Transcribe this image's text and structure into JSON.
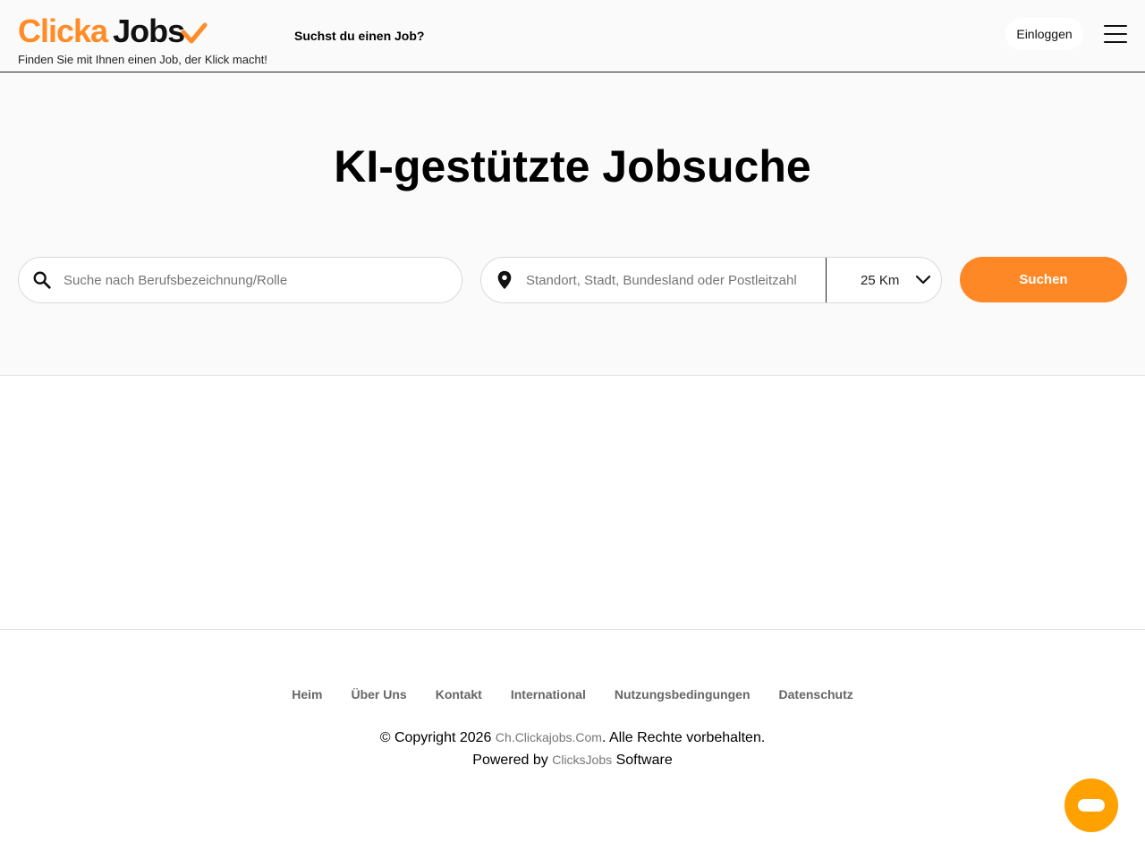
{
  "header": {
    "logo_part1": "Clicka",
    "logo_part2": "Jobs",
    "tagline": "Finden Sie mit Ihnen einen Job, der Klick macht!",
    "question": "Suchst du einen Job?",
    "login_label": "Einloggen"
  },
  "hero": {
    "title": "KI-gestützte Jobsuche",
    "search_placeholder": "Suche nach Berufsbezeichnung/Rolle",
    "location_placeholder": "Standort, Stadt, Bundesland oder Postleitzahl",
    "radius_value": "25 Km",
    "search_button": "Suchen"
  },
  "footer": {
    "links": [
      "Heim",
      "Über Uns",
      "Kontakt",
      "International",
      "Nutzungsbedingungen",
      "Datenschutz"
    ],
    "copyright_prefix": "© Copyright 2026 ",
    "copyright_site": "Ch.Clickajobs.Com",
    "copyright_suffix": ". Alle Rechte vorbehalten.",
    "powered_prefix": "Powered by ",
    "powered_brand": "ClicksJobs",
    "powered_suffix": " Software"
  },
  "colors": {
    "brand_orange": "#ff8826",
    "chat_orange": "#ffa100"
  }
}
